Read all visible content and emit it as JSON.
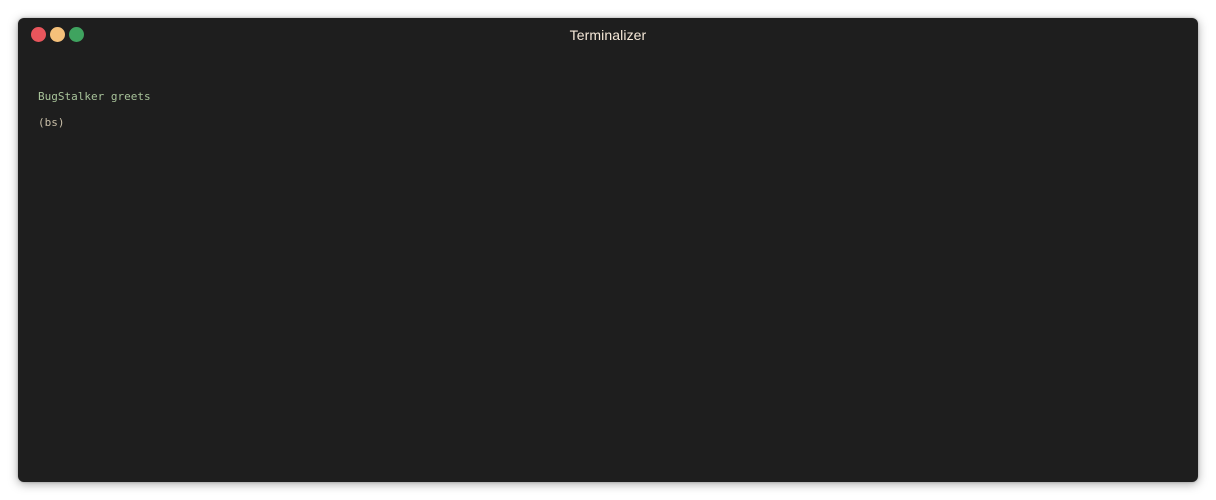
{
  "window": {
    "title": "Terminalizer",
    "background": "#1e1e1e",
    "title_color": "#f5e8d8",
    "traffic_lights": [
      {
        "name": "close",
        "color": "#e8555c"
      },
      {
        "name": "minimize",
        "color": "#f5c07a"
      },
      {
        "name": "maximize",
        "color": "#3fa35f"
      }
    ]
  },
  "terminal": {
    "lines": [
      {
        "text": "BugStalker greets",
        "color": "#a8c39a"
      },
      {
        "text": "(bs)",
        "color": "#c9bfa8"
      }
    ]
  }
}
